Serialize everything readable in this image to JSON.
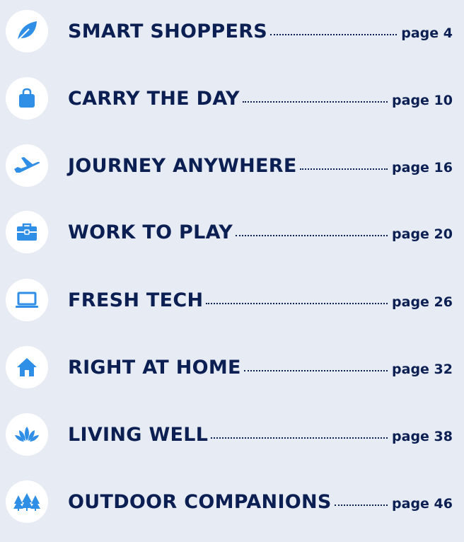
{
  "accent_color": "#2f8ee6",
  "text_color": "#0b1f52",
  "background_color": "#e7ebf3",
  "entries": [
    {
      "icon": "leaf-icon",
      "title": "SMART SHOPPERS",
      "page": "page 4"
    },
    {
      "icon": "shopping-bag-icon",
      "title": "CARRY THE DAY",
      "page": "page 10"
    },
    {
      "icon": "airplane-icon",
      "title": "JOURNEY ANYWHERE",
      "page": "page 16"
    },
    {
      "icon": "briefcase-icon",
      "title": "WORK TO PLAY",
      "page": "page 20"
    },
    {
      "icon": "laptop-icon",
      "title": "FRESH TECH",
      "page": "page 26"
    },
    {
      "icon": "house-icon",
      "title": "RIGHT AT HOME",
      "page": "page 32"
    },
    {
      "icon": "lotus-icon",
      "title": "LIVING WELL",
      "page": "page 38"
    },
    {
      "icon": "pine-trees-icon",
      "title": "OUTDOOR COMPANIONS",
      "page": "page 46"
    }
  ]
}
